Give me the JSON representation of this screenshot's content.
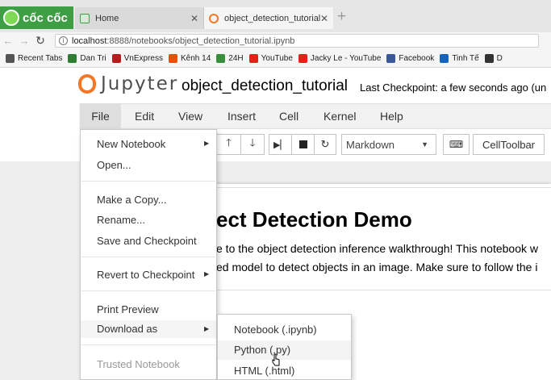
{
  "browser": {
    "logo_text": "cốc cốc",
    "tabs": [
      {
        "title": "Home",
        "active": false
      },
      {
        "title": "object_detection_tutorial",
        "active": true
      }
    ],
    "new_tab_symbol": "+",
    "url_host": "localhost",
    "url_path": ":8888/notebooks/object_detection_tutorial.ipynb",
    "bookmarks": [
      {
        "label": "Recent Tabs",
        "icon": "clock-icon",
        "color": "#555555"
      },
      {
        "label": "Dan Tri",
        "icon": "dantri-icon",
        "color": "#2e7d32"
      },
      {
        "label": "VnExpress",
        "icon": "vnexpress-icon",
        "color": "#b71c1c"
      },
      {
        "label": "Kênh 14",
        "icon": "kenh14-icon",
        "color": "#e65100"
      },
      {
        "label": "24H",
        "icon": "24h-icon",
        "color": "#388e3c"
      },
      {
        "label": "YouTube",
        "icon": "youtube-icon",
        "color": "#e62117"
      },
      {
        "label": "Jacky Le - YouTube",
        "icon": "youtube-icon",
        "color": "#e62117"
      },
      {
        "label": "Facebook",
        "icon": "facebook-icon",
        "color": "#3b5998"
      },
      {
        "label": "Tinh Tế",
        "icon": "tinhte-icon",
        "color": "#1565c0"
      },
      {
        "label": "D",
        "icon": "doc-icon",
        "color": "#333333"
      }
    ]
  },
  "jupyter": {
    "logo_text": "Jupyter",
    "notebook_title": "object_detection_tutorial",
    "checkpoint": "Last Checkpoint: a few seconds ago (un",
    "menus": [
      "File",
      "Edit",
      "View",
      "Insert",
      "Cell",
      "Kernel",
      "Help"
    ],
    "toolbar": {
      "cell_type": "Markdown",
      "celltoolbar_label": "CellToolbar"
    },
    "file_menu": {
      "new_notebook": "New Notebook",
      "open": "Open...",
      "make_copy": "Make a Copy...",
      "rename": "Rename...",
      "save_checkpoint": "Save and Checkpoint",
      "revert": "Revert to Checkpoint",
      "print_preview": "Print Preview",
      "download_as": "Download as",
      "trusted": "Trusted Notebook"
    },
    "download_submenu": [
      "Notebook (.ipynb)",
      "Python (.py)",
      "HTML (.html)"
    ],
    "content": {
      "heading": "ect Detection Demo",
      "line1": "e to the object detection inference walkthrough! This notebook w",
      "line2": "ed model to detect objects in an image. Make sure to follow the i"
    }
  },
  "colors": {
    "jupyter_orange": "#f37726",
    "coccoc_green": "#3e9e43"
  }
}
